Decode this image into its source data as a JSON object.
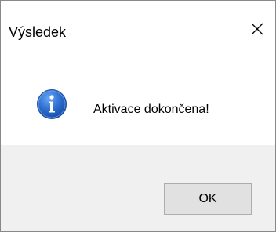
{
  "window": {
    "title": "Výsledek",
    "close_icon": "close-icon"
  },
  "content": {
    "icon": "info-icon",
    "message": "Aktivace dokončena!"
  },
  "footer": {
    "ok_label": "OK"
  },
  "colors": {
    "content_bg": "#ffffff",
    "footer_bg": "#f0f0f0",
    "button_bg": "#e1e1e1",
    "button_border": "#adadad",
    "icon_blue": "#1e62c8"
  }
}
